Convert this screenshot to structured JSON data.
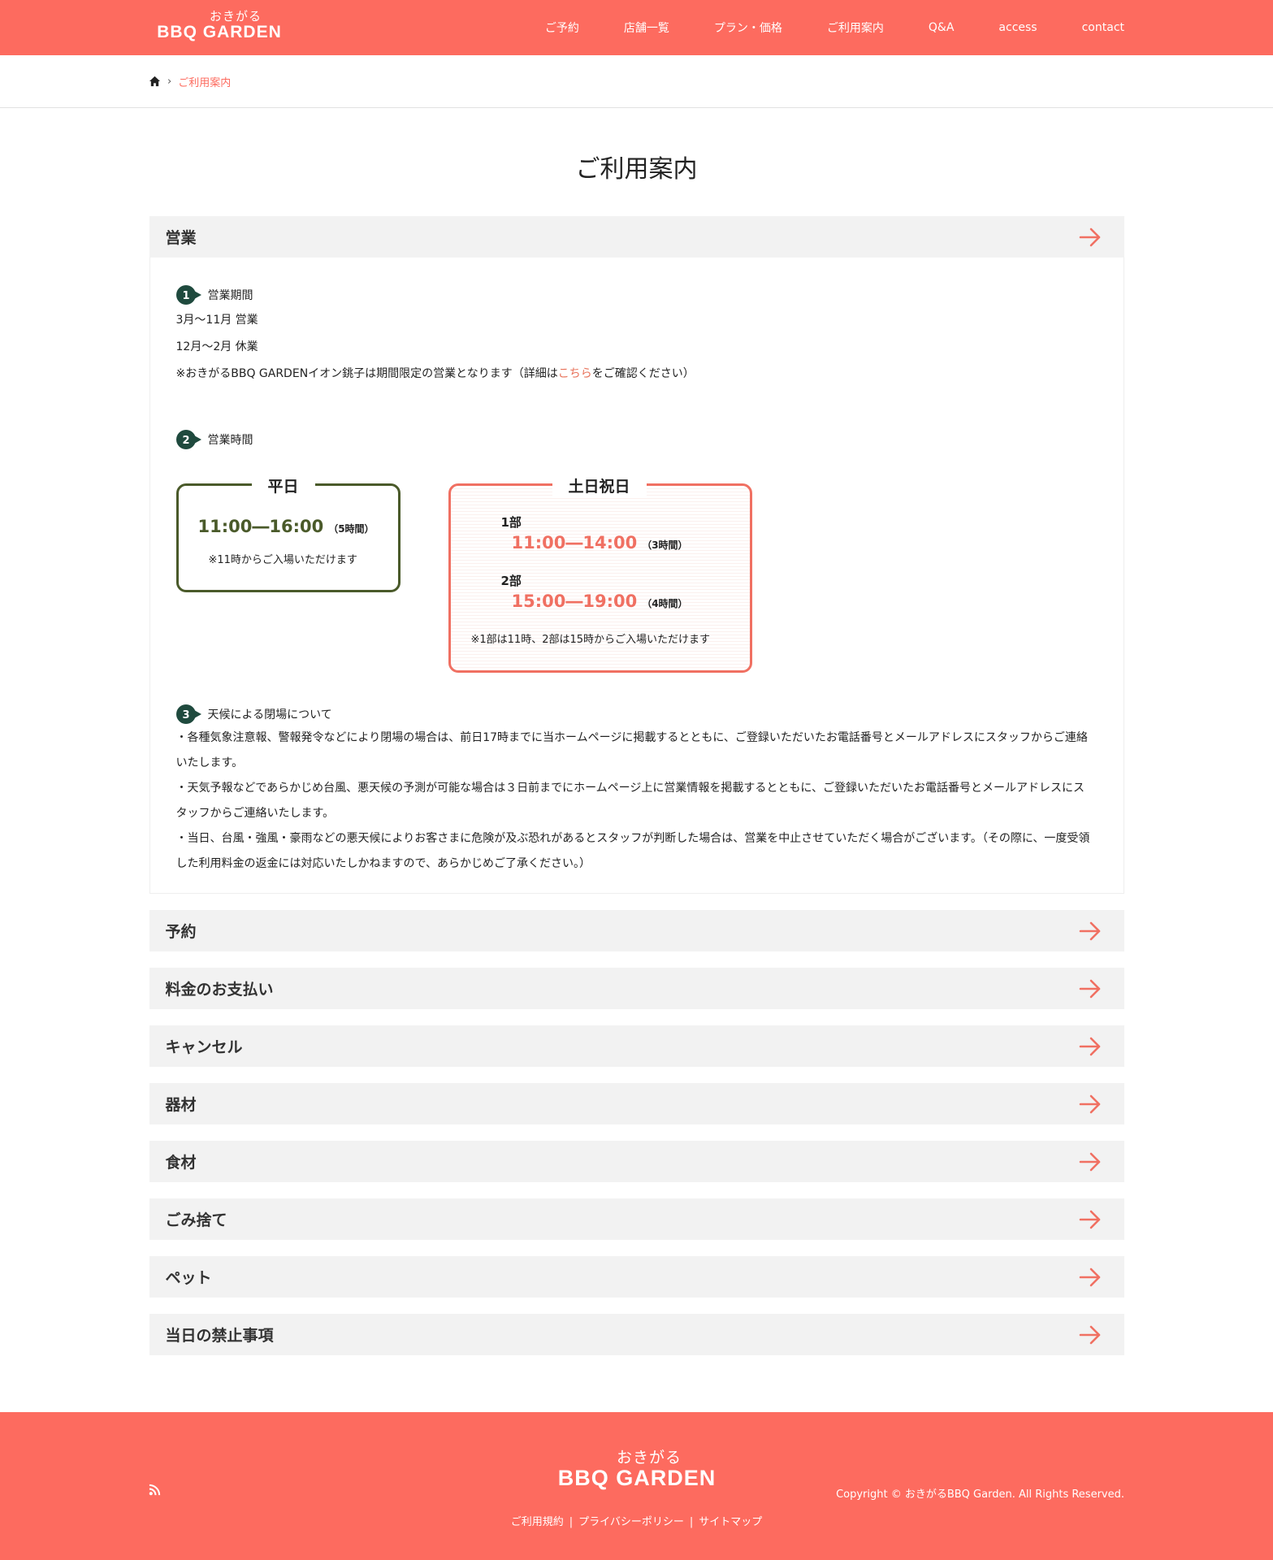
{
  "header": {
    "logo_kana": "おきがる",
    "logo_main": "BBQ GARDEN",
    "nav": [
      "ご予約",
      "店舗一覧",
      "プラン・価格",
      "ご利用案内",
      "Q&A",
      "access",
      "contact"
    ]
  },
  "breadcrumb": {
    "current": "ご利用案内"
  },
  "page_title": "ご利用案内",
  "accordion": [
    {
      "label": "営業",
      "expanded": true
    },
    {
      "label": "予約"
    },
    {
      "label": "料金のお支払い"
    },
    {
      "label": "キャンセル"
    },
    {
      "label": "器材"
    },
    {
      "label": "食材"
    },
    {
      "label": "ごみ捨て"
    },
    {
      "label": "ペット"
    },
    {
      "label": "当日の禁止事項"
    }
  ],
  "business": {
    "sec1": {
      "num": "1",
      "title": "営業期間",
      "line1": "3月～11月 営業",
      "line2": "12月～2月 休業",
      "note_pre": "※おきがるBBQ GARDENイオン銚子は期間限定の営業となります（詳細は",
      "note_link": "こちら",
      "note_post": "をご確認ください）"
    },
    "sec2": {
      "num": "2",
      "title": "営業時間",
      "weekday": {
        "title": "平日",
        "time": "11:00―16:00",
        "hours": "（5時間）",
        "note": "※11時からご入場いただけます"
      },
      "weekend": {
        "title": "土日祝日",
        "part1_label": "1部",
        "part1_time": "11:00―14:00",
        "part1_hours": "（3時間）",
        "part2_label": "2部",
        "part2_time": "15:00―19:00",
        "part2_hours": "（4時間）",
        "note": "※1部は11時、2部は15時からご入場いただけます"
      }
    },
    "sec3": {
      "num": "3",
      "title": "天候による閉場について",
      "p1a": "・各種気象注意報、警報発令などにより閉場の場合は、前日17時までに当ホームページに掲載するとともに、ご登録いただいたお電話番号とメールアドレスにスタッフからご連絡",
      "p1b": "いたします。",
      "p2a": "・天気予報などであらかじめ台風、悪天候の予測が可能な場合は３日前までにホームページ上に営業情報を掲載するとともに、ご登録いただいたお電話番号とメールアドレスにス",
      "p2b": "タッフからご連絡いたします。",
      "p3a": "・当日、台風・強風・豪雨などの悪天候によりお客さまに危険が及ぶ恐れがあるとスタッフが判断した場合は、営業を中止させていただく場合がございます。（その際に、一度受領",
      "p3b": "した利用料金の返金には対応いたしかねますので、あらかじめご了承ください。）"
    }
  },
  "footer": {
    "logo_kana": "おきがる",
    "logo_main": "BBQ GARDEN",
    "copyright": "Copyright © おきがるBBQ Garden. All Rights Reserved.",
    "links": [
      "ご利用規約",
      "プライバシーポリシー",
      "サイトマップ"
    ],
    "link_separator": "|"
  },
  "colors": {
    "brand": "#fd6b5f",
    "dark_green": "#1f4a3e",
    "olive": "#4a5a2a",
    "accent": "#f07062"
  },
  "icons": {
    "home": "home-icon",
    "arrow": "arrow-right-icon",
    "rss": "rss-icon"
  }
}
